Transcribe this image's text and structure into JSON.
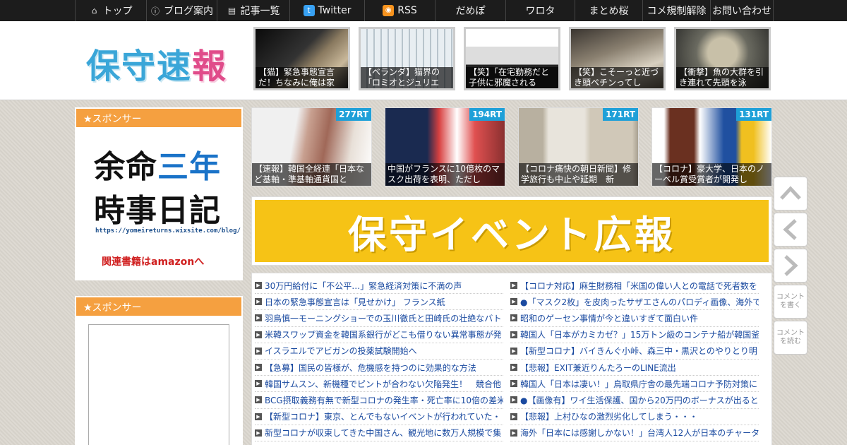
{
  "nav": {
    "items": [
      {
        "icon": "home-icon",
        "label": "トップ"
      },
      {
        "icon": "info-icon",
        "label": "ブログ案内"
      },
      {
        "icon": "list-icon",
        "label": "記事一覧"
      },
      {
        "icon": "twitter-icon",
        "label": "Twitter"
      },
      {
        "icon": "rss-icon",
        "label": "RSS"
      },
      {
        "icon": "",
        "label": "だめぽ"
      },
      {
        "icon": "",
        "label": "ワロタ"
      },
      {
        "icon": "",
        "label": "まとめ桜"
      },
      {
        "icon": "",
        "label": "コメ規制解除"
      },
      {
        "icon": "",
        "label": "お問い合わせ"
      }
    ]
  },
  "header": {
    "logo": "保守速報",
    "thumbs": [
      {
        "caption": "【猫】緊急事態宣言だ！ちなみに俺は家"
      },
      {
        "caption": "【ベランダ】猫界の「ロミオとジュリエ"
      },
      {
        "caption": "【笑】「在宅勤務だと子供に邪魔される"
      },
      {
        "caption": "【笑】こそーっと近づき頭ペチンってし"
      },
      {
        "caption": "【衝撃】魚の大群を引き連れて先頭を泳"
      }
    ]
  },
  "sidebar": {
    "widget1_title": "★スポンサー",
    "ad1": {
      "line1a": "余命",
      "line1b": "三年",
      "line2": "時事日記",
      "url": "https://yomeireturns.wixsite.com/blog/",
      "link": "関連書籍はamazonへ"
    },
    "widget2_title": "★スポンサー"
  },
  "main": {
    "rt_items": [
      {
        "badge": "277RT",
        "caption": "【速報】韓国全経連「日本など基軸・準基軸通貨国と"
      },
      {
        "badge": "194RT",
        "caption": "中国がフランスに10億枚のマスク出荷を表明、ただし"
      },
      {
        "badge": "171RT",
        "caption": "【コロナ痛快の朝日新聞】修学旅行も中止や延期　新"
      },
      {
        "badge": "131RT",
        "caption": "【コロナ】豪大学、日本のノーベル賞受賞者が開発し"
      }
    ],
    "banner": "保守イベント広報",
    "links_left": [
      "30万円給付に「不公平…」緊急経済対策に不満の声",
      "日本の緊急事態宣言は「見せかけ」 フランス紙",
      "羽鳥慎一モーニングショーでの玉川徹氏と田崎氏の壮絶なバト",
      "米韓スワップ資金を韓国系銀行がどこも借りない異常事態が発",
      "イスラエルでアビガンの投薬試験開始へ",
      "【急募】国民の皆様が、危機感を持つのに効果的な方法",
      "韓国サムスン、新機種でピントが合わない欠陥発生！　競合他",
      "BCG摂取義務有無で新型コロナの発生率・死亡率に10倍の差米",
      "【新型コロナ】東京、とんでもないイベントが行われていた・",
      "新型コロナが収束してきた中国さん、観光地に数万人規模で集"
    ],
    "links_right": [
      "【コロナ対応】麻生財務相「米国の偉い人との電話で死者数を",
      "●「マスク2枚」を皮肉ったサザエさんのパロディ画像、海外で",
      "昭和のゲーセン事情が今と違いすぎて面白い件",
      "韓国人「日本がカミカゼ？」15万トン級のコンテナ船が韓国釜",
      "【新型コロナ】バイきんぐ小峠、森三中・黒沢とのやりとり明",
      "【悲報】EXIT兼近りんたろーのLINE流出",
      "韓国人「日本は凄い！」鳥取県庁舎の最先端コロナ予防対策に",
      "●【画像有】ワイ生活保護、国から20万円のボーナスが出ると知",
      "【悲報】上村ひなの激烈劣化してしまう・・・",
      "海外「日本には感謝しかない！」台湾人12人が日本のチャータ"
    ]
  },
  "floating": {
    "comment_write": "コメントを書く",
    "comment_read": "コメントを読む"
  }
}
